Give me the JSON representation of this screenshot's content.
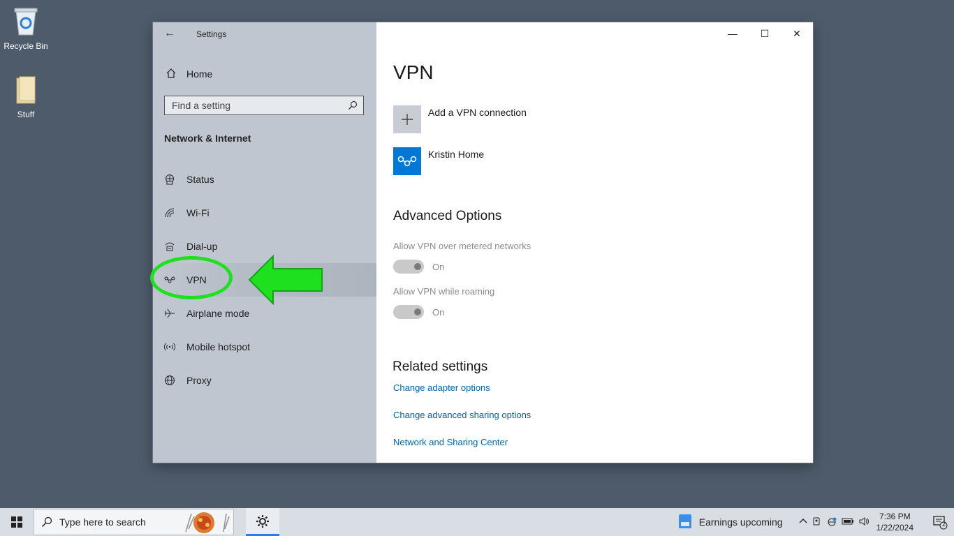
{
  "desktop": {
    "icons": [
      {
        "label": "Recycle Bin",
        "icon": "recycle-bin-icon"
      },
      {
        "label": "Stuff",
        "icon": "folder-icon"
      }
    ]
  },
  "window": {
    "title": "Settings",
    "controls": {
      "minimize": "—",
      "maximize": "☐",
      "close": "✕"
    }
  },
  "sidebar": {
    "home_label": "Home",
    "search_placeholder": "Find a setting",
    "section_title": "Network & Internet",
    "items": [
      {
        "label": "Status",
        "icon": "status-globe-icon"
      },
      {
        "label": "Wi-Fi",
        "icon": "wifi-icon"
      },
      {
        "label": "Dial-up",
        "icon": "dialup-icon"
      },
      {
        "label": "VPN",
        "icon": "vpn-icon",
        "active": true
      },
      {
        "label": "Airplane mode",
        "icon": "airplane-icon"
      },
      {
        "label": "Mobile hotspot",
        "icon": "hotspot-icon"
      },
      {
        "label": "Proxy",
        "icon": "globe-icon"
      }
    ]
  },
  "main": {
    "title": "VPN",
    "add_vpn_label": "Add a VPN connection",
    "connections": [
      {
        "name": "Kristin Home"
      }
    ],
    "advanced": {
      "title": "Advanced Options",
      "options": [
        {
          "label": "Allow VPN over metered networks",
          "state": "On"
        },
        {
          "label": "Allow VPN while roaming",
          "state": "On"
        }
      ]
    },
    "related": {
      "title": "Related settings",
      "links": [
        "Change adapter options",
        "Change advanced sharing options",
        "Network and Sharing Center"
      ]
    }
  },
  "taskbar": {
    "search_placeholder": "Type here to search",
    "news": "Earnings upcoming",
    "time": "7:36 PM",
    "date": "1/22/2024",
    "notification_count": "2"
  },
  "colors": {
    "accent": "#0078d7",
    "link": "#0063b1",
    "highlight": "#1ee01e",
    "sidebar": "#bfc6cf",
    "desktop": "#4d5b6b"
  }
}
